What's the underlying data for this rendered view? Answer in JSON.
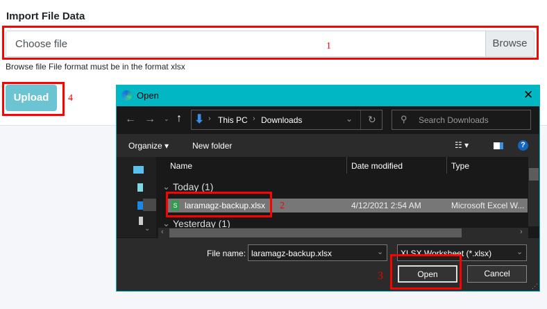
{
  "form": {
    "title": "Import File Data",
    "file_placeholder": "Choose file",
    "browse_label": "Browse",
    "help_text": "Browse file File format must be in the format xlsx",
    "upload_label": "Upload"
  },
  "annotations": [
    "1",
    "2",
    "3",
    "4"
  ],
  "dialog": {
    "title": "Open",
    "breadcrumb": [
      "This PC",
      "Downloads"
    ],
    "search_placeholder": "Search Downloads",
    "organize_label": "Organize",
    "new_folder_label": "New folder",
    "columns": [
      "Name",
      "Date modified",
      "Type"
    ],
    "groups": [
      "Today (1)",
      "Yesterday (1)"
    ],
    "files": [
      {
        "name": "laramagz-backup.xlsx",
        "date": "4/12/2021 2:54 AM",
        "type": "Microsoft Excel W..."
      }
    ],
    "file_name_label": "File name:",
    "file_name_value": "laramagz-backup.xlsx",
    "file_type_value": "XLSX Worksheet (*.xlsx)",
    "open_label": "Open",
    "cancel_label": "Cancel"
  },
  "colors": {
    "accent": "#00b7c3",
    "annotation": "#ff0000",
    "upload": "#6cc3d1"
  }
}
